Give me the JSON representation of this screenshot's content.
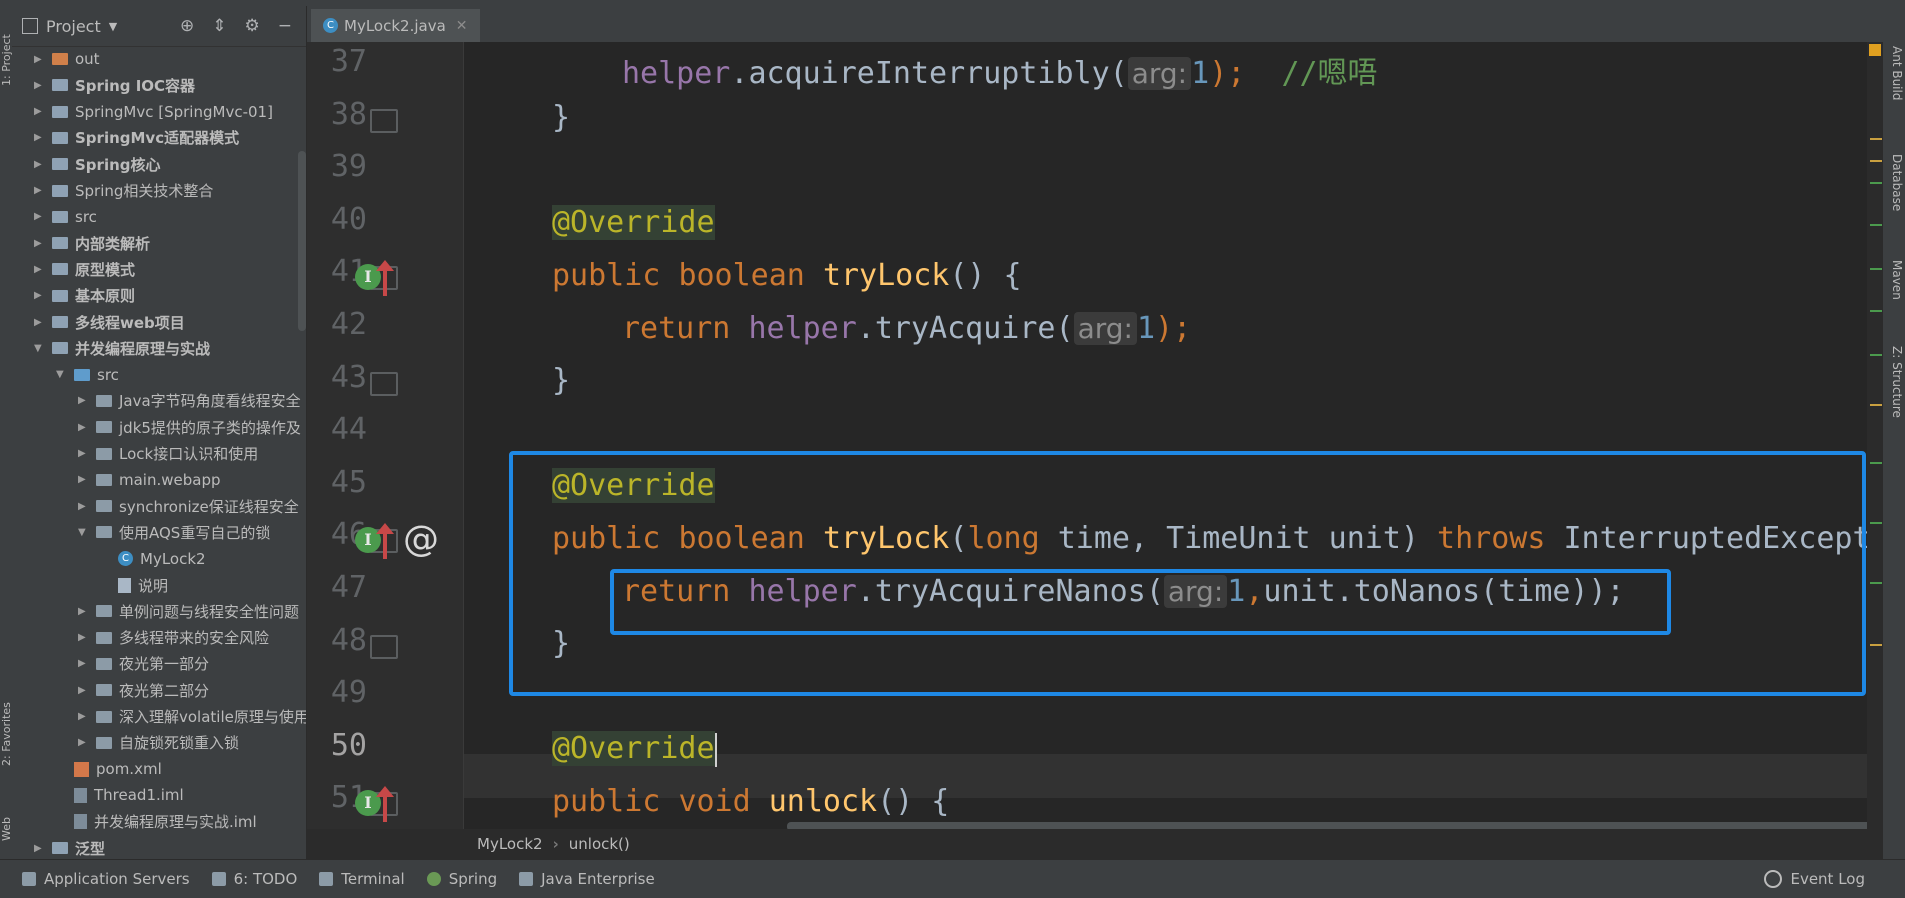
{
  "project_panel": {
    "title": "Project",
    "tree": [
      {
        "label": "out",
        "type": "folder-out",
        "depth": 0,
        "expanded": false,
        "bold": false
      },
      {
        "label": "Spring IOC容器",
        "type": "module",
        "depth": 0,
        "expanded": false,
        "bold": true
      },
      {
        "label": "SpringMvc [SpringMvc-01]",
        "type": "module",
        "depth": 0,
        "expanded": false,
        "bold": false
      },
      {
        "label": "SpringMvc适配器模式",
        "type": "module",
        "depth": 0,
        "expanded": false,
        "bold": true
      },
      {
        "label": "Spring核心",
        "type": "module",
        "depth": 0,
        "expanded": false,
        "bold": true
      },
      {
        "label": "Spring相关技术整合",
        "type": "module",
        "depth": 0,
        "expanded": false,
        "bold": false
      },
      {
        "label": "src",
        "type": "module",
        "depth": 0,
        "expanded": false,
        "bold": false
      },
      {
        "label": "内部类解析",
        "type": "module",
        "depth": 0,
        "expanded": false,
        "bold": true
      },
      {
        "label": "原型模式",
        "type": "module",
        "depth": 0,
        "expanded": false,
        "bold": true
      },
      {
        "label": "基本原则",
        "type": "module",
        "depth": 0,
        "expanded": false,
        "bold": true
      },
      {
        "label": "多线程web项目",
        "type": "module",
        "depth": 0,
        "expanded": false,
        "bold": true
      },
      {
        "label": "并发编程原理与实战",
        "type": "module",
        "depth": 0,
        "expanded": true,
        "bold": true
      },
      {
        "label": "src",
        "type": "folder-src",
        "depth": 1,
        "expanded": true,
        "bold": false
      },
      {
        "label": "Java字节码角度看线程安全",
        "type": "package",
        "depth": 2,
        "expanded": false,
        "bold": false
      },
      {
        "label": "jdk5提供的原子类的操作及",
        "type": "package",
        "depth": 2,
        "expanded": false,
        "bold": false
      },
      {
        "label": "Lock接口认识和使用",
        "type": "package",
        "depth": 2,
        "expanded": false,
        "bold": false
      },
      {
        "label": "main.webapp",
        "type": "package",
        "depth": 2,
        "expanded": false,
        "bold": false
      },
      {
        "label": "synchronize保证线程安全",
        "type": "package",
        "depth": 2,
        "expanded": false,
        "bold": false
      },
      {
        "label": "使用AQS重写自己的锁",
        "type": "package",
        "depth": 2,
        "expanded": true,
        "bold": false
      },
      {
        "label": "MyLock2",
        "type": "java",
        "depth": 3,
        "expanded": null,
        "bold": false
      },
      {
        "label": "说明",
        "type": "file",
        "depth": 3,
        "expanded": null,
        "bold": false
      },
      {
        "label": "单例问题与线程安全性问题",
        "type": "package",
        "depth": 2,
        "expanded": false,
        "bold": false
      },
      {
        "label": "多线程带来的安全风险",
        "type": "package",
        "depth": 2,
        "expanded": false,
        "bold": false
      },
      {
        "label": "夜光第一部分",
        "type": "package",
        "depth": 2,
        "expanded": false,
        "bold": false
      },
      {
        "label": "夜光第二部分",
        "type": "package",
        "depth": 2,
        "expanded": false,
        "bold": false
      },
      {
        "label": "深入理解volatile原理与使用",
        "type": "package",
        "depth": 2,
        "expanded": false,
        "bold": false
      },
      {
        "label": "自旋锁死锁重入锁",
        "type": "package",
        "depth": 2,
        "expanded": false,
        "bold": false
      },
      {
        "label": "pom.xml",
        "type": "xml",
        "depth": 1,
        "expanded": null,
        "bold": false
      },
      {
        "label": "Thread1.iml",
        "type": "iml",
        "depth": 1,
        "expanded": null,
        "bold": false
      },
      {
        "label": "并发编程原理与实战.iml",
        "type": "iml",
        "depth": 1,
        "expanded": null,
        "bold": false
      },
      {
        "label": "泛型",
        "type": "module",
        "depth": 0,
        "expanded": false,
        "bold": true
      }
    ]
  },
  "left_strip": {
    "project_label": "1: Project",
    "favorites_label": "2: Favorites",
    "web_label": "Web"
  },
  "right_strip": {
    "ant": "Ant Build",
    "database": "Database",
    "maven": "Maven",
    "structure": "Z: Structure"
  },
  "editor": {
    "tab_label": "MyLock2.java",
    "line_numbers": [
      "37",
      "38",
      "39",
      "40",
      "41",
      "42",
      "43",
      "44",
      "45",
      "46",
      "47",
      "48",
      "49",
      "50",
      "51"
    ],
    "current_line": "50",
    "code": {
      "l37": {
        "obj": "helper",
        "dot": ".",
        "method": "acquireInterruptibly",
        "open": "(",
        "hint": "arg:",
        "num": "1",
        "close": ");",
        "comment": "//嗯唔"
      },
      "l38": {
        "brace": "}"
      },
      "l40": {
        "annotation": "@Override"
      },
      "l41": {
        "kw1": "public",
        "kw2": "boolean",
        "method": "tryLock",
        "rest": "() {"
      },
      "l42": {
        "kw": "return",
        "obj": "helper",
        "dot": ".",
        "method": "tryAcquire",
        "open": "(",
        "hint": "arg:",
        "num": "1",
        "close": ");"
      },
      "l43": {
        "brace": "}"
      },
      "l45": {
        "annotation": "@Override"
      },
      "l46": {
        "kw1": "public",
        "kw2": "boolean",
        "method": "tryLock",
        "open": "(",
        "kw3": "long",
        "p1": " time, TimeUnit unit) ",
        "kw4": "throws",
        "exc": " InterruptedExcepti"
      },
      "l47": {
        "kw": "return",
        "obj": "helper",
        "dot": ".",
        "method": "tryAcquireNanos",
        "open": "(",
        "hint": "arg:",
        "num": "1",
        "comma": ",",
        "rest": "unit.toNanos(time));"
      },
      "l48": {
        "brace": "}"
      },
      "l50": {
        "annotation": "@Override"
      },
      "l51": {
        "kw1": "public",
        "kw2": "void",
        "method": "unlock",
        "rest": "() {"
      }
    }
  },
  "breadcrumb": {
    "class": "MyLock2",
    "method": "unlock()"
  },
  "bottom_toolbar": {
    "items": [
      "Application Servers",
      "6: TODO",
      "Terminal",
      "Spring",
      "Java Enterprise"
    ],
    "event_log": "Event Log"
  },
  "colors": {
    "selection_box": "#1e88e5",
    "keyword": "#cc7832",
    "annotation": "#bbb529",
    "field": "#9876aa",
    "method": "#ffc66d",
    "number": "#6897bb",
    "comment": "#629755"
  }
}
